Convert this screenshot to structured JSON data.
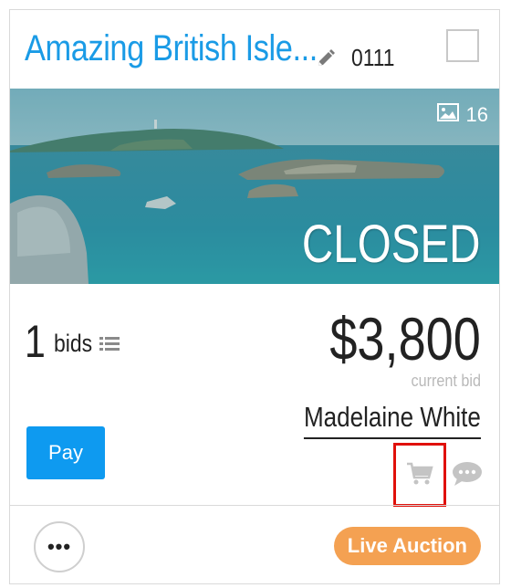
{
  "item": {
    "title": "Amazing British Isle...",
    "lot_number": "0111",
    "photo_count": "16",
    "status": "CLOSED"
  },
  "bids": {
    "count": "1",
    "label": "bids"
  },
  "price": {
    "amount": "$3,800",
    "caption": "current bid",
    "bidder": "Madelaine White"
  },
  "actions": {
    "pay_label": "Pay",
    "more_label": "•••",
    "badge_label": "Live Auction"
  },
  "icons": {
    "edit": "pencil-icon",
    "photos": "image-icon",
    "bids_list": "list-icon",
    "cart": "cart-icon",
    "chat": "chat-icon"
  },
  "colors": {
    "title": "#1a9be6",
    "pay_button": "#0e9af0",
    "badge": "#f4a152",
    "highlight": "#e0100a",
    "caption": "#b9b9b9"
  }
}
